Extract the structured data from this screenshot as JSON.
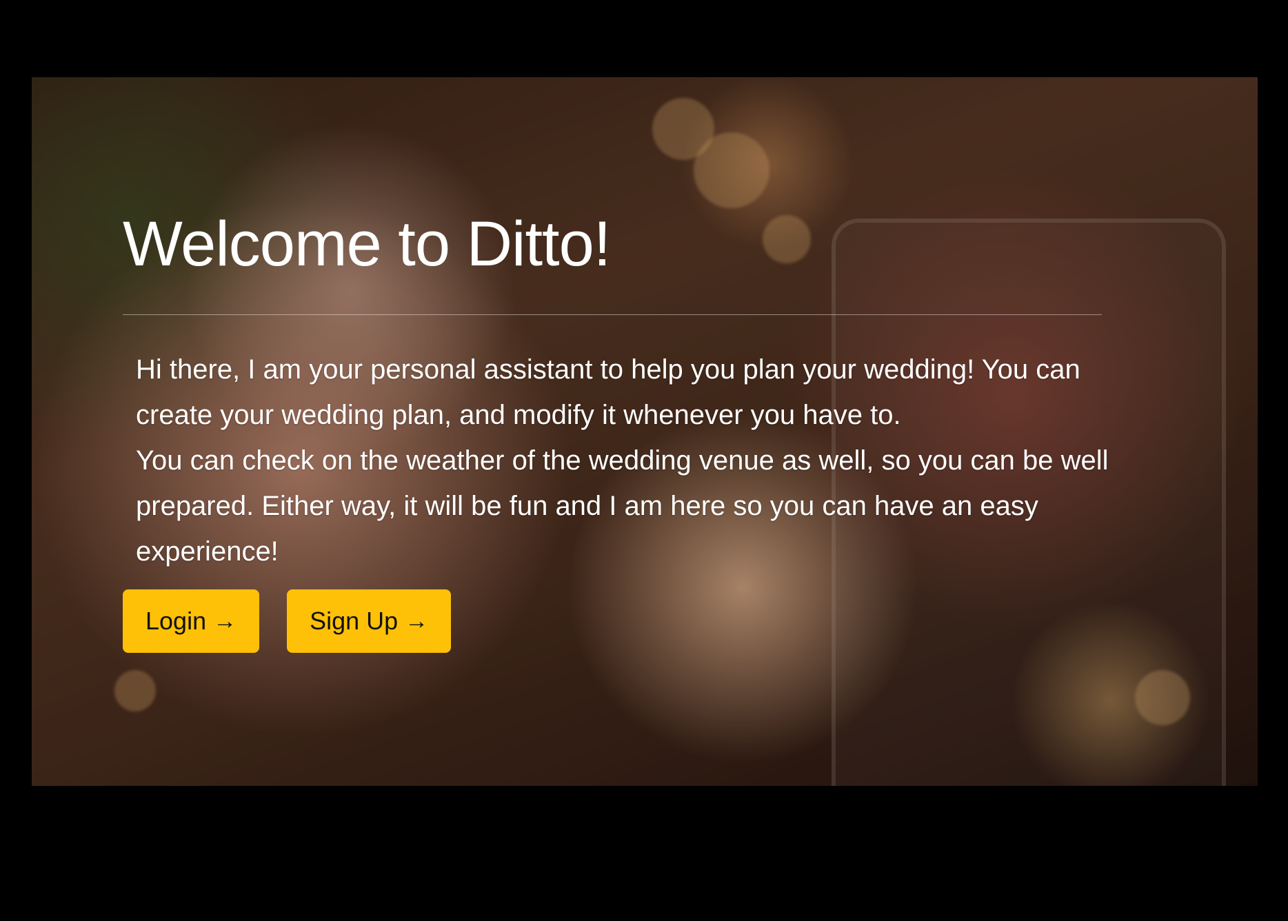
{
  "hero": {
    "title": "Welcome to Ditto!",
    "description_lines": [
      "Hi there, I am your personal assistant to help you plan your wedding! You can create your wedding plan, and modify it whenever you have to.",
      "You can check on the weather of the wedding venue as well, so you can be well prepared. Either way, it will be fun and I am here so you can have an easy experience!"
    ],
    "buttons": {
      "login_label": "Login",
      "signup_label": "Sign Up",
      "arrow_icon": "arrow-right-icon"
    }
  },
  "colors": {
    "page_background": "#000000",
    "button_background": "#ffc107",
    "button_text": "#111111",
    "text": "#ffffff"
  }
}
